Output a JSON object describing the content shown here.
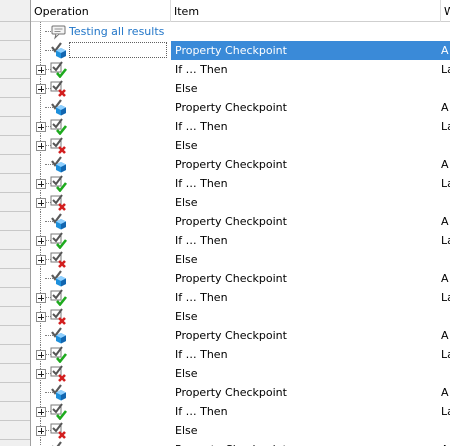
{
  "columns": {
    "operation": "Operation",
    "item": "Item",
    "w": "W"
  },
  "comment_row": {
    "label": "Testing all results"
  },
  "rows": [
    {
      "type": "property",
      "item": "Property Checkpoint",
      "w": "A",
      "selected": true
    },
    {
      "type": "if",
      "item": "If … Then",
      "w": "La"
    },
    {
      "type": "else",
      "item": "Else",
      "w": ""
    },
    {
      "type": "property",
      "item": "Property Checkpoint",
      "w": "A"
    },
    {
      "type": "if",
      "item": "If … Then",
      "w": "La"
    },
    {
      "type": "else",
      "item": "Else",
      "w": ""
    },
    {
      "type": "property",
      "item": "Property Checkpoint",
      "w": "A"
    },
    {
      "type": "if",
      "item": "If … Then",
      "w": "La"
    },
    {
      "type": "else",
      "item": "Else",
      "w": ""
    },
    {
      "type": "property",
      "item": "Property Checkpoint",
      "w": "A"
    },
    {
      "type": "if",
      "item": "If … Then",
      "w": "La"
    },
    {
      "type": "else",
      "item": "Else",
      "w": ""
    },
    {
      "type": "property",
      "item": "Property Checkpoint",
      "w": "A"
    },
    {
      "type": "if",
      "item": "If … Then",
      "w": "La"
    },
    {
      "type": "else",
      "item": "Else",
      "w": ""
    },
    {
      "type": "property",
      "item": "Property Checkpoint",
      "w": "A"
    },
    {
      "type": "if",
      "item": "If … Then",
      "w": "La"
    },
    {
      "type": "else",
      "item": "Else",
      "w": ""
    },
    {
      "type": "property",
      "item": "Property Checkpoint",
      "w": "A"
    },
    {
      "type": "if",
      "item": "If … Then",
      "w": "La"
    },
    {
      "type": "else",
      "item": "Else",
      "w": ""
    },
    {
      "type": "property",
      "item": "Property Checkpoint",
      "w": "A"
    }
  ],
  "icons": {
    "comment": "comment-icon",
    "property": "property-checkpoint-icon",
    "if": "if-then-check-icon",
    "else": "else-cross-icon"
  },
  "colors": {
    "selection": "#3a8ad8",
    "link": "#2276c8",
    "check": "#1eaa1e",
    "cross": "#d21e1e",
    "cube": "#1e90dc"
  }
}
